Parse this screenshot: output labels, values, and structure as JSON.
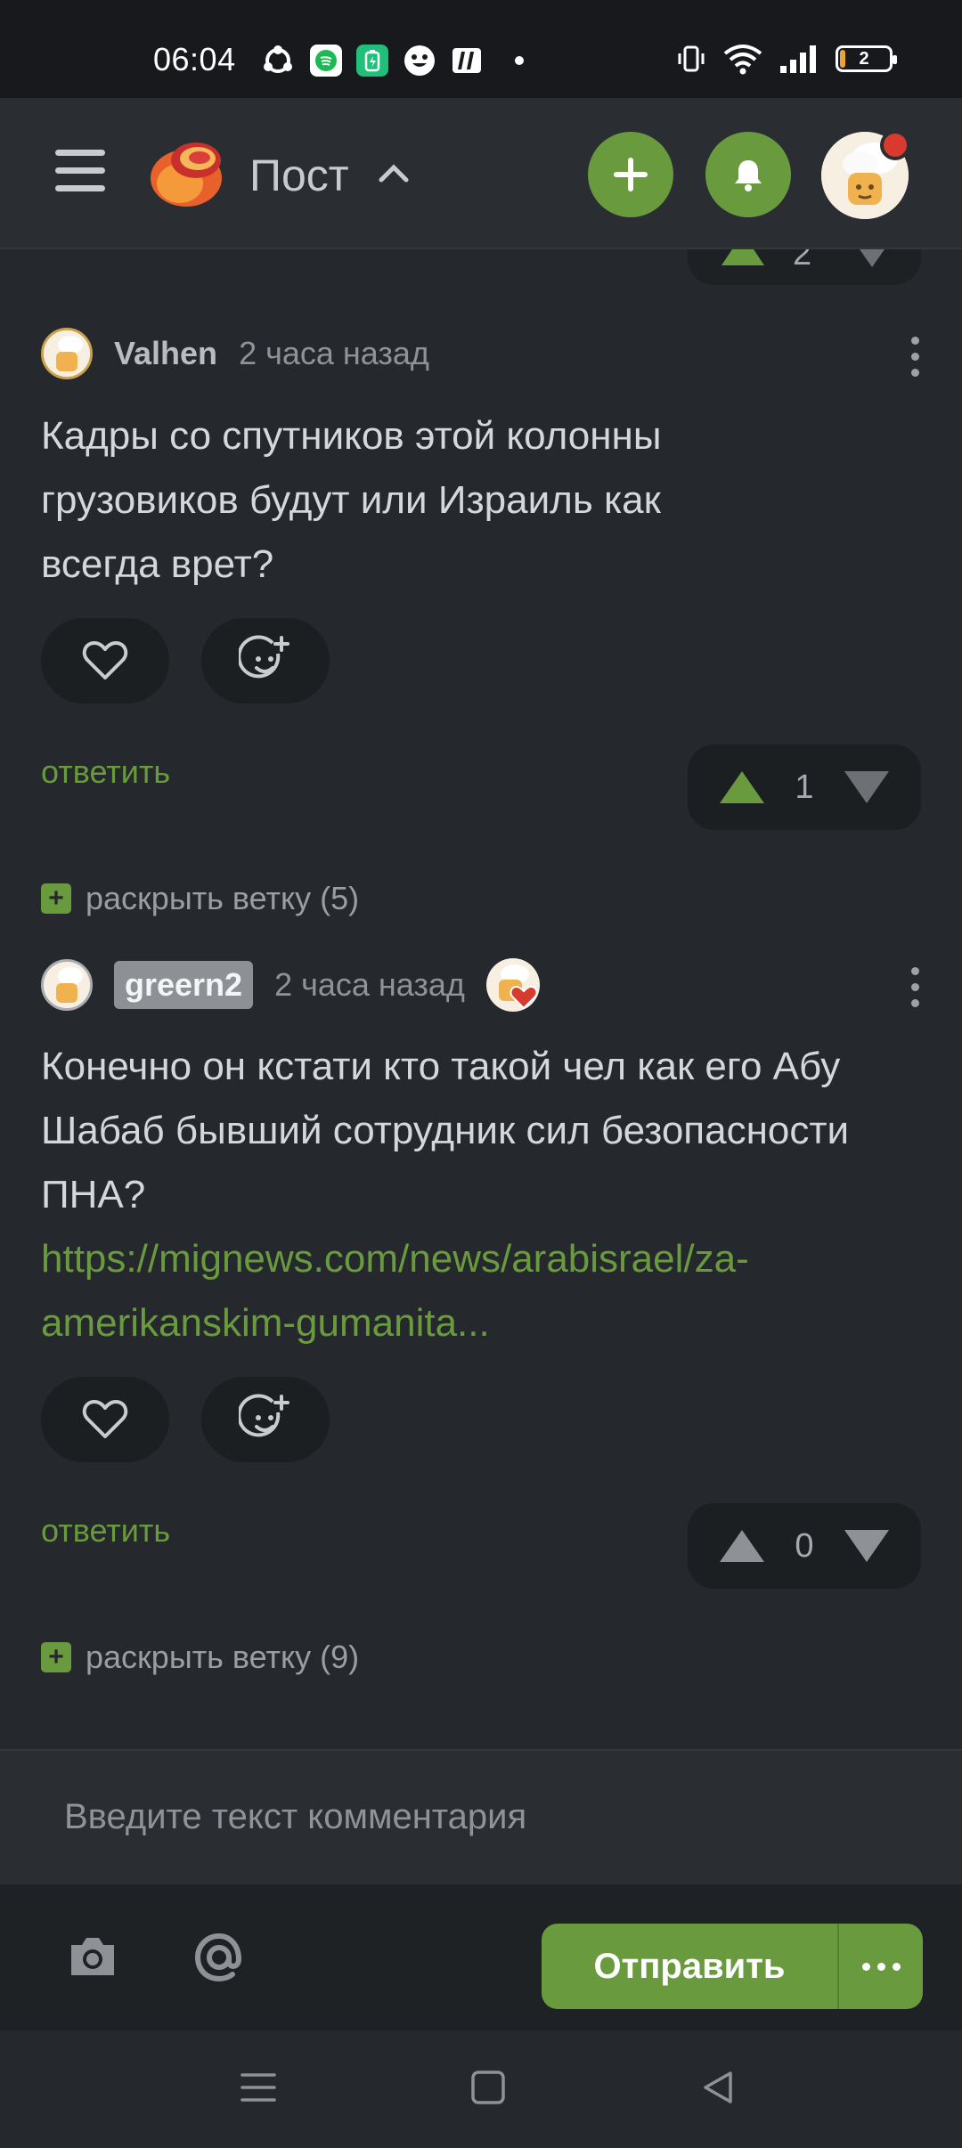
{
  "status_bar": {
    "time": "06:04",
    "battery_level": "2",
    "icons": [
      "sync-icon",
      "spotify-icon",
      "battery-saver-icon",
      "face-icon",
      "app-icon",
      "vibrate-icon",
      "wifi-icon",
      "signal-icon"
    ]
  },
  "header": {
    "title": "Пост",
    "colors": {
      "accent": "#6a9a3e",
      "badge": "#d83a2e"
    }
  },
  "comments": [
    {
      "username": "Valhen",
      "time": "2 часа назад",
      "text": "Кадры со спутников этой колонны грузовиков будут или Израиль как всегда врет?",
      "reply_label": "ответить",
      "votes": "1",
      "expand_label": "раскрыть ветку (5)"
    },
    {
      "username": "greern2",
      "time": "2 часа назад",
      "text": "Конечно он кстати кто такой чел как его Абу Шабаб бывший сотрудник сил безопасности ПНА?",
      "link": "https://mignews.com/news/arabisrael/za-amerikanskim-gumanita...",
      "reply_label": "ответить",
      "votes": "0",
      "expand_label": "раскрыть ветку (9)"
    }
  ],
  "partial_vote": {
    "votes": "2"
  },
  "composer": {
    "placeholder": "Введите текст комментария",
    "send_label": "Отправить"
  }
}
